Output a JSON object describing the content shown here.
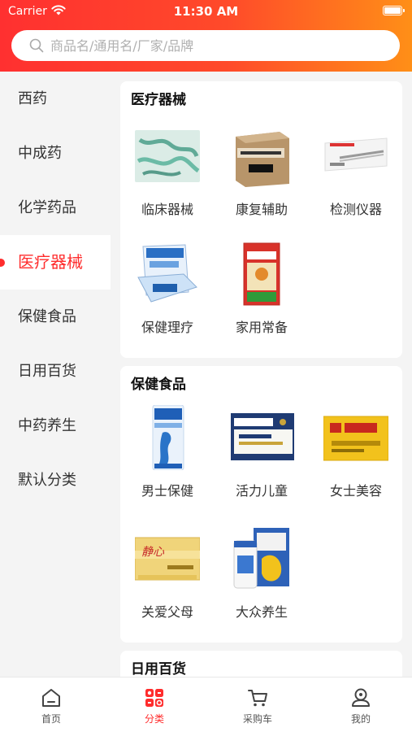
{
  "status_bar": {
    "carrier": "Carrier",
    "time": "11:30 AM"
  },
  "search": {
    "placeholder": "商品名/通用名/厂家/品牌"
  },
  "sidebar": {
    "items": [
      {
        "label": "西药"
      },
      {
        "label": "中成药"
      },
      {
        "label": "化学药品"
      },
      {
        "label": "医疗器械",
        "active": true
      },
      {
        "label": "保健食品"
      },
      {
        "label": "日用百货"
      },
      {
        "label": "中药养生"
      },
      {
        "label": "默认分类"
      }
    ]
  },
  "sections": [
    {
      "title": "医疗器械",
      "items": [
        {
          "label": "临床器械",
          "image": "tubing-set-product"
        },
        {
          "label": "康复辅助",
          "image": "cardboard-box-product"
        },
        {
          "label": "检测仪器",
          "image": "thermometer-product"
        },
        {
          "label": "保健理疗",
          "image": "medical-box-product"
        },
        {
          "label": "家用常备",
          "image": "plaster-box-product"
        }
      ]
    },
    {
      "title": "保健食品",
      "items": [
        {
          "label": "男士保健",
          "image": "supplement-bottle-product"
        },
        {
          "label": "活力儿童",
          "image": "biostime-box-product"
        },
        {
          "label": "女士美容",
          "image": "yellow-box-product"
        },
        {
          "label": "关爱父母",
          "image": "gold-box-product"
        },
        {
          "label": "大众养生",
          "image": "calcium-bottle-product"
        }
      ]
    },
    {
      "title": "日用百货",
      "items": []
    }
  ],
  "tabbar": {
    "items": [
      {
        "label": "首页",
        "icon": "home-icon"
      },
      {
        "label": "分类",
        "icon": "category-icon",
        "active": true
      },
      {
        "label": "采购车",
        "icon": "cart-icon"
      },
      {
        "label": "我的",
        "icon": "profile-icon"
      }
    ]
  },
  "colors": {
    "accent": "#ff2d2d",
    "header_start": "#ff3030",
    "header_end": "#ff8f17"
  }
}
